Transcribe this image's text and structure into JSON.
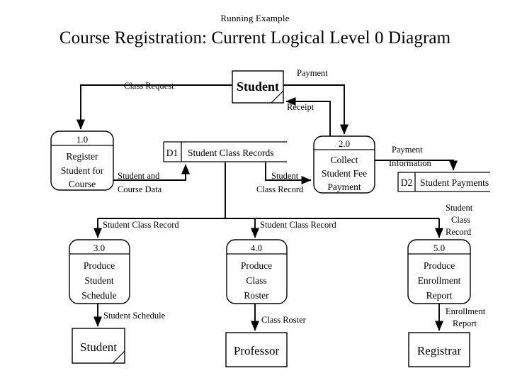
{
  "header": {
    "subtitle": "Running Example",
    "title": "Course Registration: Current Logical Level 0 Diagram"
  },
  "diagram": {
    "type": "data-flow-diagram",
    "notation": "Gane-Sarson / DeMarco Level 0",
    "external_entities": [
      {
        "id": "ee-student-top",
        "name": "Student",
        "duplicate_mark": true
      },
      {
        "id": "ee-student-bottom",
        "name": "Student",
        "duplicate_mark": true
      },
      {
        "id": "ee-professor",
        "name": "Professor",
        "duplicate_mark": false
      },
      {
        "id": "ee-registrar",
        "name": "Registrar",
        "duplicate_mark": false
      }
    ],
    "processes": [
      {
        "id": "p1",
        "number": "1.0",
        "lines": [
          "Register",
          "Student for",
          "Course"
        ]
      },
      {
        "id": "p2",
        "number": "2.0",
        "lines": [
          "Collect",
          "Student Fee",
          "Payment"
        ]
      },
      {
        "id": "p3",
        "number": "3.0",
        "lines": [
          "Produce",
          "Student",
          "Schedule"
        ]
      },
      {
        "id": "p4",
        "number": "4.0",
        "lines": [
          "Produce",
          "Class",
          "Roster"
        ]
      },
      {
        "id": "p5",
        "number": "5.0",
        "lines": [
          "Produce",
          "Enrollment",
          "Report"
        ]
      }
    ],
    "data_stores": [
      {
        "id": "d1",
        "code": "D1",
        "name": "Student Class Records"
      },
      {
        "id": "d2",
        "code": "D2",
        "name": "Student Payments"
      }
    ],
    "data_flows": [
      {
        "id": "f-class-request",
        "label": "Class Request",
        "from": "ee-student-top",
        "to": "p1"
      },
      {
        "id": "f-payment",
        "label": "Payment",
        "from": "ee-student-top",
        "to": "p2"
      },
      {
        "id": "f-receipt",
        "label": "Receipt",
        "from": "p2",
        "to": "ee-student-top"
      },
      {
        "id": "f-student-course-data",
        "label_line1": "Student and",
        "label_line2": "Course Data",
        "from": "p1",
        "to": "d1"
      },
      {
        "id": "f-scr-to-p2",
        "label_line1": "Student",
        "label_line2": "Class Record",
        "from": "d1",
        "to": "p2"
      },
      {
        "id": "f-payment-information",
        "label_line1": "Payment",
        "label_line2": "Information",
        "from": "p2",
        "to": "d2"
      },
      {
        "id": "f-scr-to-p3",
        "label": "Student Class Record",
        "from": "d1",
        "to": "p3"
      },
      {
        "id": "f-scr-to-p4",
        "label": "Student Class Record",
        "from": "d1",
        "to": "p4"
      },
      {
        "id": "f-scr-to-p5",
        "label_line1": "Student",
        "label_line2": "Class",
        "label_line3": "Record",
        "from": "d1",
        "to": "p5"
      },
      {
        "id": "f-student-schedule",
        "label": "Student Schedule",
        "from": "p3",
        "to": "ee-student-bottom"
      },
      {
        "id": "f-class-roster",
        "label": "Class Roster",
        "from": "p4",
        "to": "ee-professor"
      },
      {
        "id": "f-enrollment-report",
        "label_line1": "Enrollment",
        "label_line2": "Report",
        "from": "p5",
        "to": "ee-registrar"
      }
    ]
  }
}
